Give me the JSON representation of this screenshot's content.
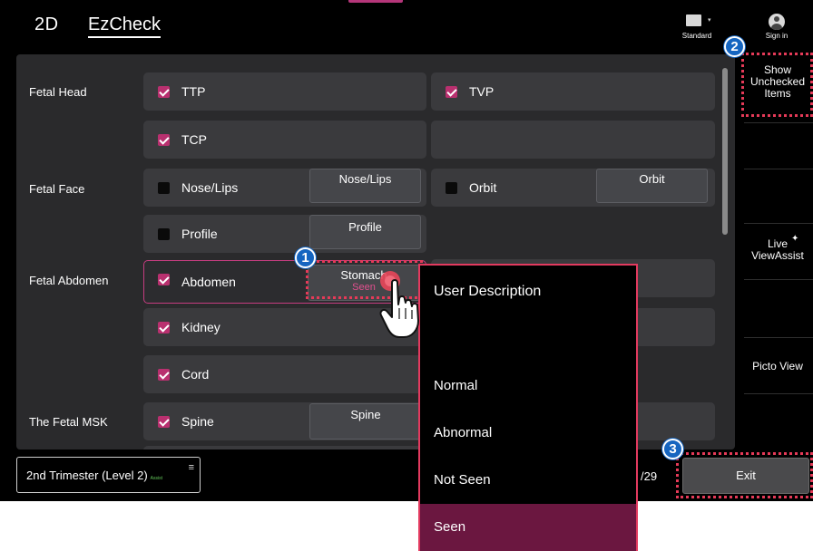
{
  "header": {
    "mode": "2D",
    "title": "EzCheck",
    "standard_label": "Standard",
    "signin_label": "Sign in"
  },
  "sidebar": {
    "show_unchecked": "Show\nUnchecked\nItems",
    "live_viewassist": "Live\nViewAssist",
    "picto_view": "Picto View"
  },
  "checklist": {
    "categories": [
      "Fetal Head",
      "Fetal Face",
      "Fetal Abdomen",
      "The Fetal MSK"
    ],
    "items": {
      "ttp": {
        "label": "TTP",
        "checked": true
      },
      "tvp": {
        "label": "TVP",
        "checked": true
      },
      "tcp": {
        "label": "TCP",
        "checked": true
      },
      "nose_lips": {
        "label": "Nose/Lips",
        "checked": false,
        "button": "Nose/Lips"
      },
      "orbit": {
        "label": "Orbit",
        "checked": false,
        "button": "Orbit"
      },
      "profile": {
        "label": "Profile",
        "checked": false,
        "button": "Profile"
      },
      "abdomen": {
        "label": "Abdomen",
        "checked": true,
        "button": "Stomach",
        "status": "Seen"
      },
      "kidney": {
        "label": "Kidney",
        "checked": true
      },
      "cord": {
        "label": "Cord",
        "checked": true
      },
      "spine": {
        "label": "Spine",
        "checked": true,
        "button": "Spine"
      }
    }
  },
  "footer": {
    "trimester": "2nd Trimester (Level 2)",
    "assist_tag": "Assist",
    "count": "/29",
    "exit": "Exit"
  },
  "dropdown": {
    "header": "User Description",
    "options": [
      "Normal",
      "Abnormal",
      "Not Seen",
      "Seen"
    ],
    "selected": "Seen"
  },
  "markers": [
    "1",
    "2",
    "3"
  ],
  "colors": {
    "accent": "#b9306f",
    "highlight": "#e53a58",
    "marker": "#1565c0",
    "selected_option": "#6b1740"
  }
}
